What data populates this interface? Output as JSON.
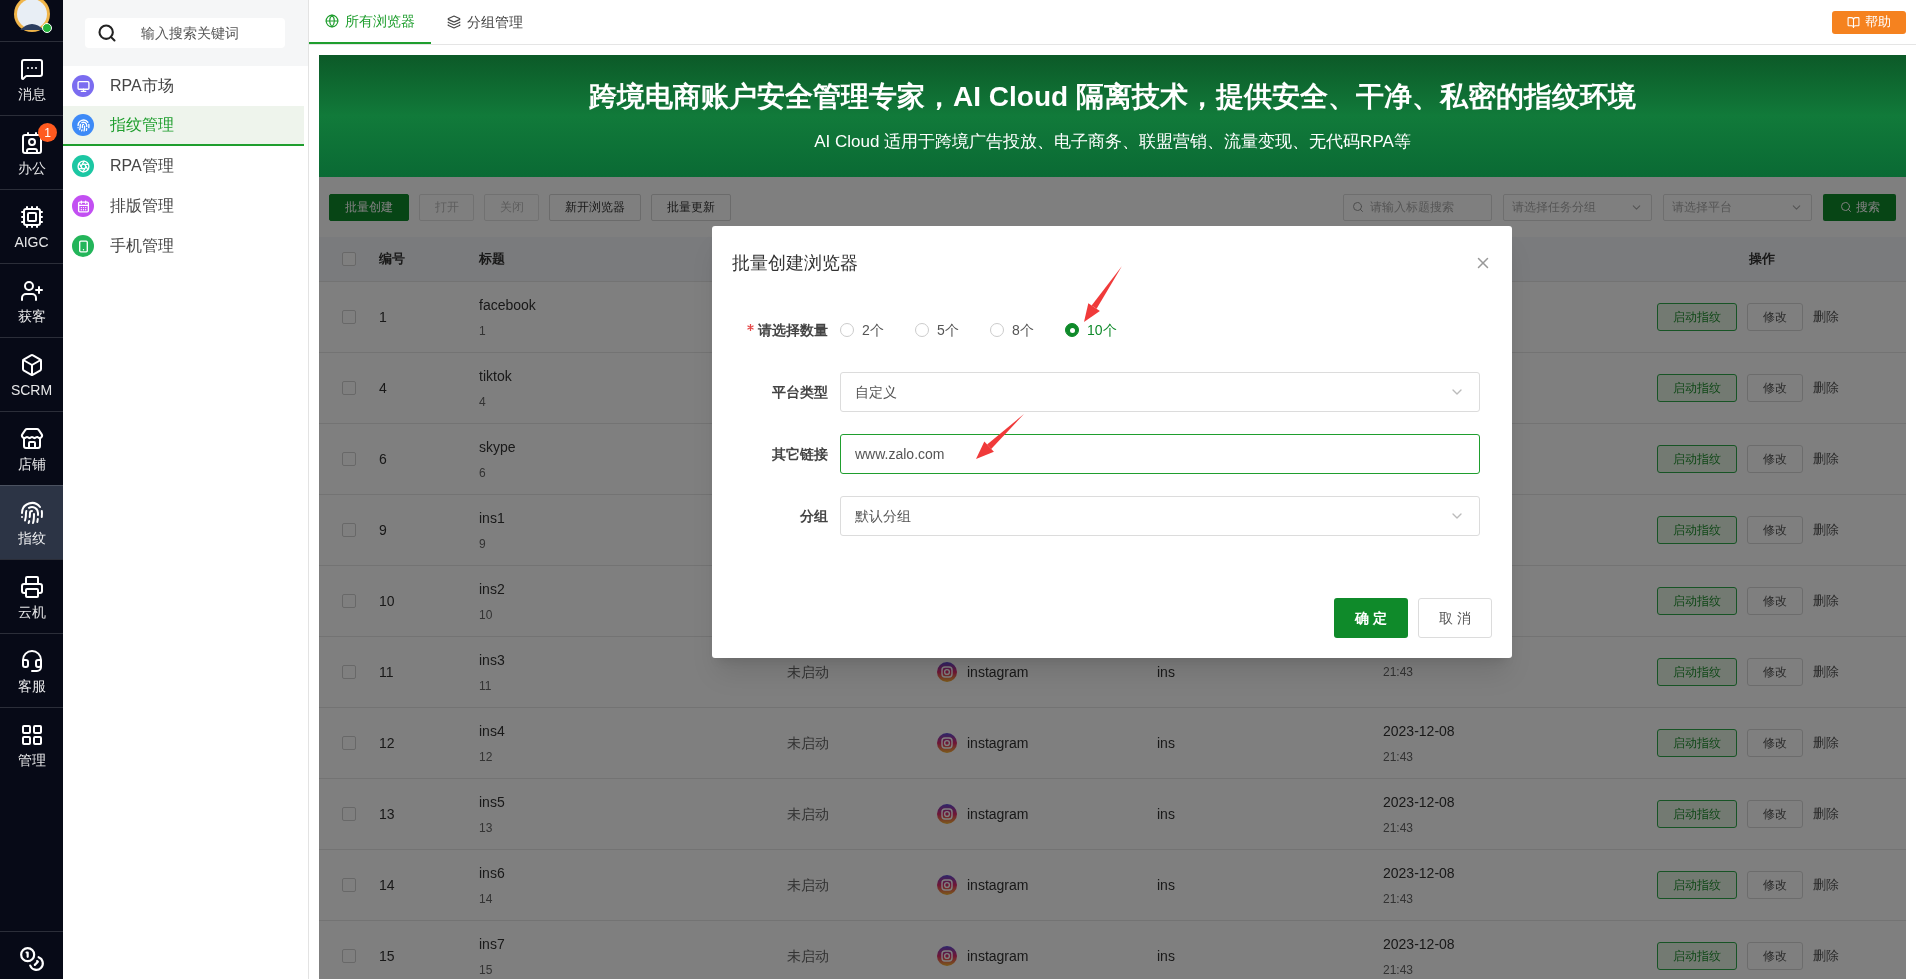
{
  "rail": {
    "online": true,
    "items": [
      {
        "label": "消息",
        "selected": false
      },
      {
        "label": "办公",
        "selected": false,
        "badge": "1"
      },
      {
        "label": "AIGC",
        "selected": false
      },
      {
        "label": "获客",
        "selected": false
      },
      {
        "label": "SCRM",
        "selected": false
      },
      {
        "label": "店铺",
        "selected": false
      },
      {
        "label": "指纹",
        "selected": true
      },
      {
        "label": "云机",
        "selected": false
      },
      {
        "label": "客服",
        "selected": false
      },
      {
        "label": "管理",
        "selected": false
      }
    ]
  },
  "nav": {
    "search_placeholder": "输入搜索关键词",
    "items": [
      {
        "label": "RPA市场",
        "color": "#7b6cf0",
        "selected": false
      },
      {
        "label": "指纹管理",
        "color": "#3d8af7",
        "selected": true
      },
      {
        "label": "RPA管理",
        "color": "#1cc7a3",
        "selected": false
      },
      {
        "label": "排版管理",
        "color": "#c24ff2",
        "selected": false
      },
      {
        "label": "手机管理",
        "color": "#23b55a",
        "selected": false
      }
    ]
  },
  "tabs": [
    {
      "label": "所有浏览器",
      "selected": true
    },
    {
      "label": "分组管理",
      "selected": false
    }
  ],
  "help_button": "帮助",
  "banner": {
    "title": "跨境电商账户安全管理专家，AI Cloud 隔离技术，提供安全、干净、私密的指纹环境",
    "subtitle": "AI Cloud 适用于跨境广告投放、电子商务、联盟营销、流量变现、无代码RPA等"
  },
  "toolbar": {
    "buttons": [
      {
        "label": "批量创建",
        "kind": "primary"
      },
      {
        "label": "打开",
        "kind": "disabled"
      },
      {
        "label": "关闭",
        "kind": "disabled"
      },
      {
        "label": "新开浏览器",
        "kind": "default"
      },
      {
        "label": "批量更新",
        "kind": "default"
      }
    ],
    "search_placeholder": "请输入标题搜索",
    "group_placeholder": "请选择任务分组",
    "platform_placeholder": "请选择平台",
    "search_button": "搜索"
  },
  "table": {
    "select_all_checked": false,
    "columns": {
      "id": "编号",
      "title": "标题",
      "actions": "操作"
    },
    "rows": [
      {
        "checked": false,
        "id": "1",
        "title": "facebook",
        "subtitle": "1",
        "actions": [
          "启动指纹",
          "修改",
          "删除"
        ]
      },
      {
        "checked": false,
        "id": "4",
        "title": "tiktok",
        "subtitle": "4",
        "actions": [
          "启动指纹",
          "修改",
          "删除"
        ]
      },
      {
        "checked": false,
        "id": "6",
        "title": "skype",
        "subtitle": "6",
        "actions": [
          "启动指纹",
          "修改",
          "删除"
        ]
      },
      {
        "checked": false,
        "id": "9",
        "title": "ins1",
        "subtitle": "9",
        "actions": [
          "启动指纹",
          "修改",
          "删除"
        ]
      },
      {
        "checked": false,
        "id": "10",
        "title": "ins2",
        "subtitle": "10",
        "actions": [
          "启动指纹",
          "修改",
          "删除"
        ]
      },
      {
        "checked": false,
        "id": "11",
        "title": "ins3",
        "subtitle": "11",
        "status": "未启动",
        "platform": "instagram",
        "group": "ins",
        "time": "21:43",
        "actions": [
          "启动指纹",
          "修改",
          "删除"
        ]
      },
      {
        "checked": false,
        "id": "12",
        "title": "ins4",
        "subtitle": "12",
        "status": "未启动",
        "platform": "instagram",
        "group": "ins",
        "date": "2023-12-08",
        "time": "21:43",
        "actions": [
          "启动指纹",
          "修改",
          "删除"
        ]
      },
      {
        "checked": false,
        "id": "13",
        "title": "ins5",
        "subtitle": "13",
        "status": "未启动",
        "platform": "instagram",
        "group": "ins",
        "date": "2023-12-08",
        "time": "21:43",
        "actions": [
          "启动指纹",
          "修改",
          "删除"
        ]
      },
      {
        "checked": false,
        "id": "14",
        "title": "ins6",
        "subtitle": "14",
        "status": "未启动",
        "platform": "instagram",
        "group": "ins",
        "date": "2023-12-08",
        "time": "21:43",
        "actions": [
          "启动指纹",
          "修改",
          "删除"
        ]
      },
      {
        "checked": false,
        "id": "15",
        "title": "ins7",
        "subtitle": "15",
        "status": "未启动",
        "platform": "instagram",
        "group": "ins",
        "date": "2023-12-08",
        "time": "21:43",
        "actions": [
          "启动指纹",
          "修改",
          "删除"
        ]
      }
    ]
  },
  "dialog": {
    "title": "批量创建浏览器",
    "fields": [
      {
        "kind": "radio",
        "label": "请选择数量",
        "required": true,
        "options": [
          {
            "label": "2个",
            "selected": false
          },
          {
            "label": "5个",
            "selected": false
          },
          {
            "label": "8个",
            "selected": false
          },
          {
            "label": "10个",
            "selected": true
          }
        ]
      },
      {
        "kind": "select",
        "label": "平台类型",
        "required": false,
        "value": "自定义"
      },
      {
        "kind": "input",
        "label": "其它链接",
        "required": false,
        "value": "www.zalo.com",
        "focused": true
      },
      {
        "kind": "select",
        "label": "分组",
        "required": false,
        "value": "默认分组"
      }
    ],
    "buttons": [
      {
        "label": "确 定",
        "kind": "primary"
      },
      {
        "label": "取 消",
        "kind": "default"
      }
    ]
  }
}
